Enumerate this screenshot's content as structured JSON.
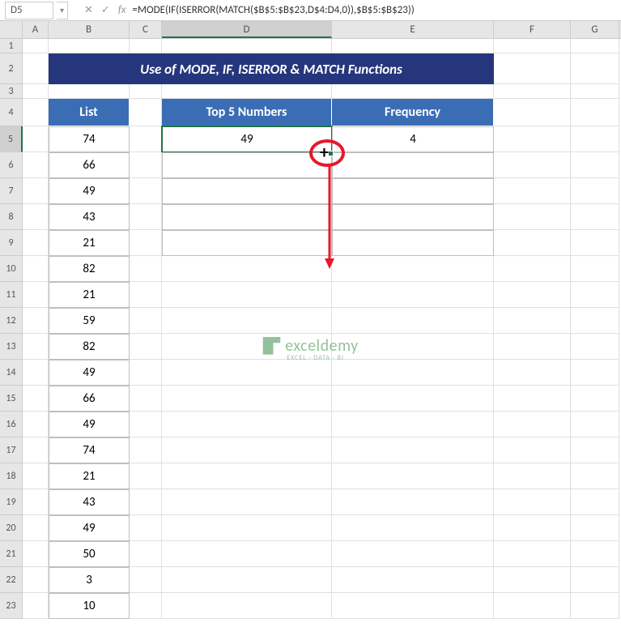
{
  "name_box": "D5",
  "formula": "=MODE(IF(ISERROR(MATCH($B$5:$B$23,D$4:D4,0)),$B$5:$B$23))",
  "columns": [
    "A",
    "B",
    "C",
    "D",
    "E",
    "F",
    "G"
  ],
  "rows": [
    1,
    2,
    3,
    4,
    5,
    6,
    7,
    8,
    9,
    10,
    11,
    12,
    13,
    14,
    15,
    16,
    17,
    18,
    19,
    20,
    21,
    22,
    23
  ],
  "title": "Use of MODE, IF, ISERROR & MATCH Functions",
  "headers": {
    "list": "List",
    "top5": "Top 5 Numbers",
    "freq": "Frequency"
  },
  "list_values": [
    "74",
    "66",
    "49",
    "43",
    "21",
    "82",
    "21",
    "59",
    "82",
    "49",
    "66",
    "49",
    "74",
    "21",
    "43",
    "49",
    "50",
    "3",
    "10"
  ],
  "top5_value": "49",
  "freq_value": "4",
  "watermark": {
    "text": "exceldemy",
    "sub": "EXCEL · DATA · BI"
  },
  "chart_data": {
    "type": "table",
    "title": "Use of MODE, IF, ISERROR & MATCH Functions",
    "list": [
      74,
      66,
      49,
      43,
      21,
      82,
      21,
      59,
      82,
      49,
      66,
      49,
      74,
      21,
      43,
      49,
      50,
      3,
      10
    ],
    "top5_numbers": [
      49
    ],
    "frequency": [
      4
    ]
  }
}
